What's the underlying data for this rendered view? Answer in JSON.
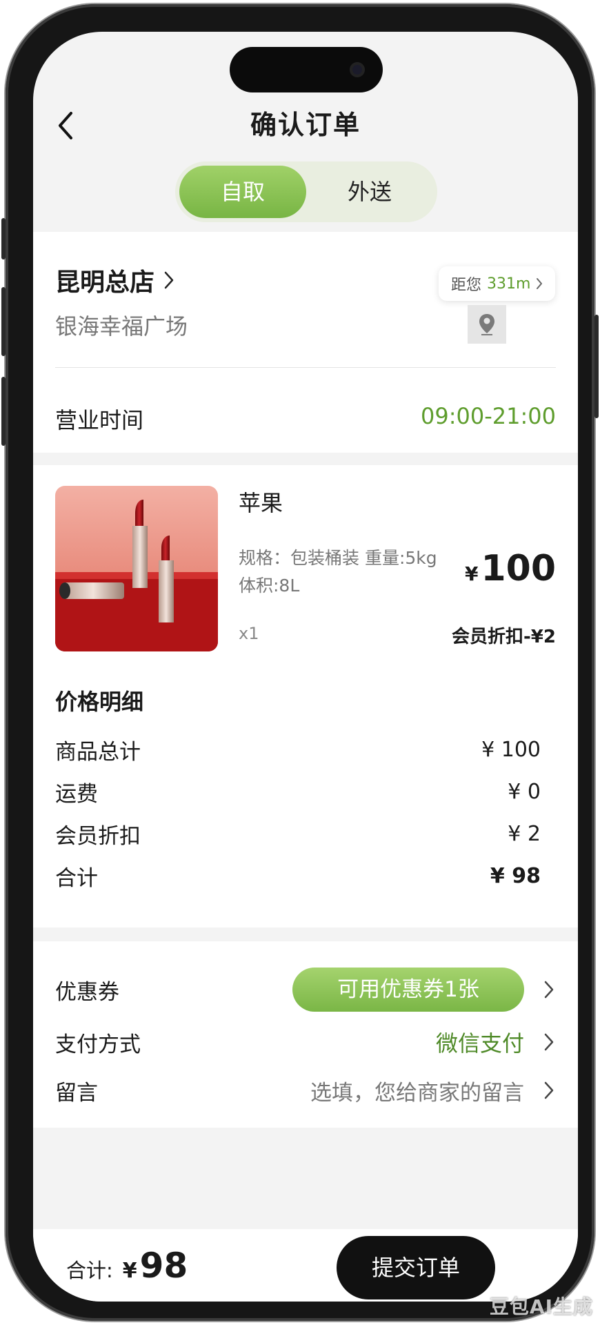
{
  "nav": {
    "title": "确认订单"
  },
  "mode_tabs": {
    "active": "自取",
    "inactive": "外送"
  },
  "store": {
    "name": "昆明总店",
    "address": "银海幸福广场",
    "distance_prefix": "距您",
    "distance_value": "331m",
    "hours_label": "营业时间",
    "hours_value": "09:00-21:00"
  },
  "product": {
    "name": "苹果",
    "spec_line1": "规格：包装桶装 重量:5kg",
    "spec_line2": "体积:8L",
    "currency": "¥",
    "price": "100",
    "quantity": "x1",
    "member_discount": "会员折扣-¥2"
  },
  "price_detail": {
    "title": "价格明细",
    "rows": [
      {
        "label": "商品总计",
        "value": "¥ 100"
      },
      {
        "label": "运费",
        "value": "¥ 0"
      },
      {
        "label": "会员折扣",
        "value": "¥ 2"
      },
      {
        "label": "合计",
        "value": "¥ 98"
      }
    ]
  },
  "extras": {
    "coupon_label": "优惠券",
    "coupon_button": "可用优惠券1张",
    "payment_label": "支付方式",
    "payment_value": "微信支付",
    "message_label": "留言",
    "message_placeholder": "选填，您给商家的留言"
  },
  "bottom": {
    "total_label": "合计:",
    "currency": "¥",
    "total_value": "98",
    "submit_label": "提交订单"
  },
  "watermark": "豆包AI生成",
  "colors": {
    "accent_green": "#7ab646",
    "text_green": "#5e9d2d",
    "button_dark": "#111111"
  }
}
